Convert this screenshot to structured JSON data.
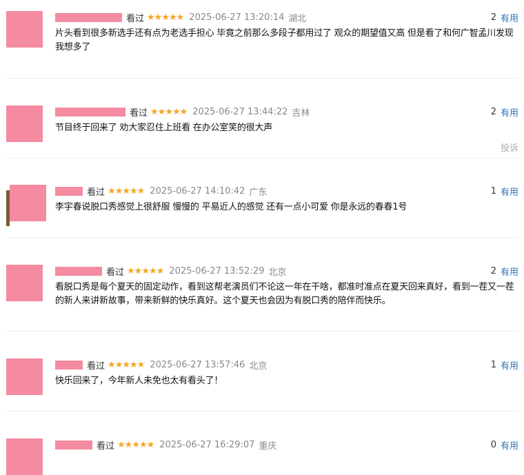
{
  "reviews": [
    {
      "watched": "看过",
      "stars": "★★★★★",
      "time": "2025-06-27 13:20:14",
      "location": "湖北",
      "useful_count": "2",
      "useful_label": "有用",
      "content": "片头看到很多新选手还有点为老选手担心 毕竟之前那么多段子都用过了 观众的期望值又高 但是看了和何广智孟川发现我想多了"
    },
    {
      "watched": "看过",
      "stars": "★★★★★",
      "time": "2025-06-27 13:44:22",
      "location": "吉林",
      "useful_count": "2",
      "useful_label": "有用",
      "content": "节目终于回来了 劝大家忍住上班看 在办公室笑的很大声",
      "report": "投诉"
    },
    {
      "watched": "看过",
      "stars": "★★★★★",
      "time": "2025-06-27 14:10:42",
      "location": "广东",
      "useful_count": "1",
      "useful_label": "有用",
      "content": "李宇春说脱口秀感觉上很舒服 慢慢的 平易近人的感觉 还有一点小可爱 你是永远的春春1号"
    },
    {
      "watched": "看过",
      "stars": "★★★★★",
      "time": "2025-06-27 13:52:29",
      "location": "北京",
      "useful_count": "2",
      "useful_label": "有用",
      "content": "看脱口秀是每个夏天的固定动作，看到这帮老演员们不论这一年在干啥，都准时准点在夏天回来真好，看到一茬又一茬的新人来讲新故事，带来新鲜的快乐真好。这个夏天也会因为有脱口秀的陪伴而快乐。"
    },
    {
      "watched": "看过",
      "stars": "★★★★★",
      "time": "2025-06-27 13:57:46",
      "location": "北京",
      "useful_count": "1",
      "useful_label": "有用",
      "content": "快乐回来了，今年新人未免也太有看头了！"
    },
    {
      "watched": "看过",
      "stars": "★★★★★",
      "time": "2025-06-27 16:29:07",
      "location": "重庆",
      "useful_count": "0",
      "useful_label": "有用",
      "content": ""
    }
  ]
}
